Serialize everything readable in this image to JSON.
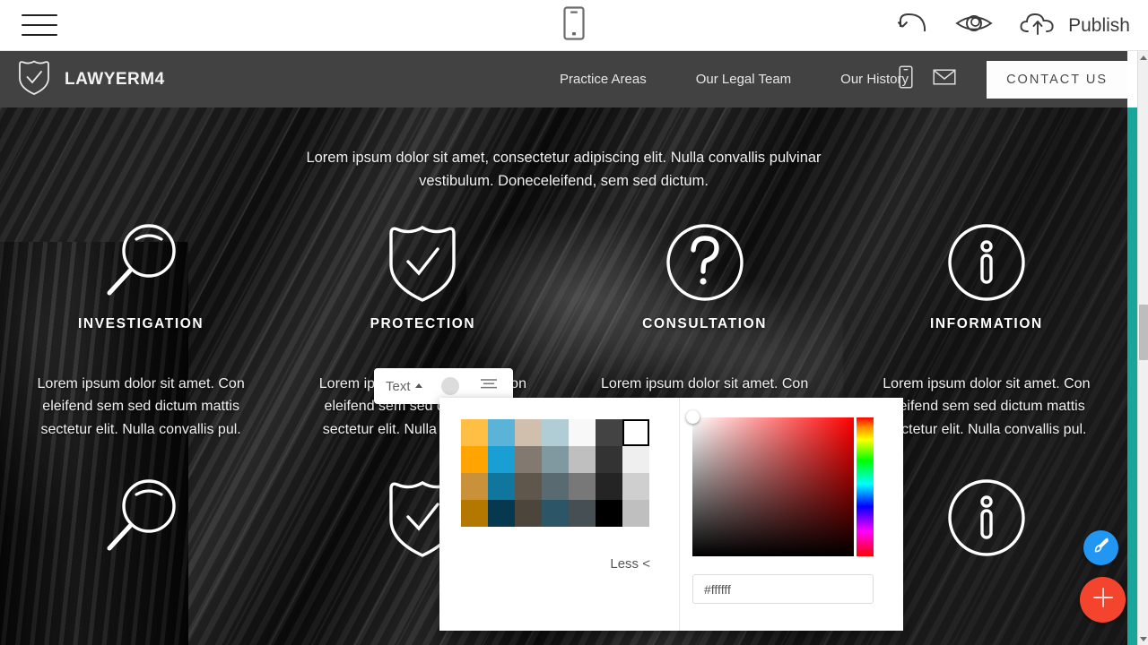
{
  "builder": {
    "menu_icon": "hamburger-menu-icon",
    "device_preview_icon": "mobile-device-icon",
    "undo_icon": "undo-arrow-icon",
    "preview_icon": "eye-preview-icon",
    "publish_icon": "cloud-upload-icon",
    "publish_label": "Publish"
  },
  "site": {
    "brand": {
      "logo_icon": "shield-check-icon",
      "name": "LAWYERM4"
    },
    "nav_links": [
      {
        "label": "Practice Areas"
      },
      {
        "label": "Our Legal Team"
      },
      {
        "label": "Our History"
      }
    ],
    "nav_icons": [
      {
        "name": "mobile-phone-icon"
      },
      {
        "name": "envelope-mail-icon"
      }
    ],
    "contact_button": "CONTACT US",
    "hero": {
      "subtitle": "Lorem ipsum dolor sit amet, consectetur adipiscing elit. Nulla convallis pulvinar vestibulum. Doneceleifend, sem sed dictum.",
      "features": [
        {
          "icon": "magnifier-search-icon",
          "title": "INVESTIGATION",
          "text": "Lorem ipsum dolor sit amet. Con eleifend sem sed dictum mattis sectetur elit. Nulla convallis pul."
        },
        {
          "icon": "shield-check-icon",
          "title": "PROTECTION",
          "text": "Lorem ipsum dolor sit amet. Con eleifend sem sed dictum mattis sectetur elit. Nulla convallis pul."
        },
        {
          "icon": "question-mark-circle-icon",
          "title": "CONSULTATION",
          "text": "Lorem ipsum dolor sit amet. Con eleifend sem sed dictum mattis sectetur elit. Nulla convallis pul."
        },
        {
          "icon": "info-circle-icon",
          "title": "INFORMATION",
          "text": "Lorem ipsum dolor sit amet. Con eleifend sem sed dictum mattis sectetur elit. Nulla convallis pul."
        }
      ],
      "features_row2": [
        {
          "icon": "magnifier-search-icon"
        },
        {
          "icon": "shield-check-icon"
        },
        {
          "icon": "question-mark-circle-icon"
        },
        {
          "icon": "info-circle-icon"
        }
      ]
    }
  },
  "inline_toolbar": {
    "text_label": "Text",
    "caret_icon": "caret-up-icon",
    "color_swatch_value": "#dcdcdc",
    "align_icon": "text-align-center-icon"
  },
  "color_picker": {
    "selected_swatch_index": 6,
    "swatches": [
      "#ffbf44",
      "#5bb4d8",
      "#cfbfac",
      "#b0ccd4",
      "#f8f8f8",
      "#434343",
      "#ffffff",
      "#ffa400",
      "#1a9fd4",
      "#827a70",
      "#8099a0",
      "#bfbfbf",
      "#333333",
      "#efefef",
      "#c8913a",
      "#10769e",
      "#5f564c",
      "#596a70",
      "#787878",
      "#242424",
      "#cfcfcf",
      "#b47700",
      "#06394f",
      "#4c453c",
      "#2c5668",
      "#464f54",
      "#000000",
      "#bfbfbf"
    ],
    "less_label": "Less <",
    "hue": "#ff0000",
    "hex_value": "#ffffff",
    "hex_placeholder": "#ffffff"
  },
  "fabs": [
    {
      "name": "style-brush-button",
      "icon": "paint-brush-icon",
      "color": "#2196f3"
    },
    {
      "name": "add-block-button",
      "icon": "plus-icon",
      "color": "#f4442e"
    }
  ],
  "scrollbar": {
    "up_icon": "scroll-up-arrow-icon",
    "down_icon": "scroll-down-arrow-icon"
  },
  "accent": {
    "teal": "#18a69b"
  }
}
